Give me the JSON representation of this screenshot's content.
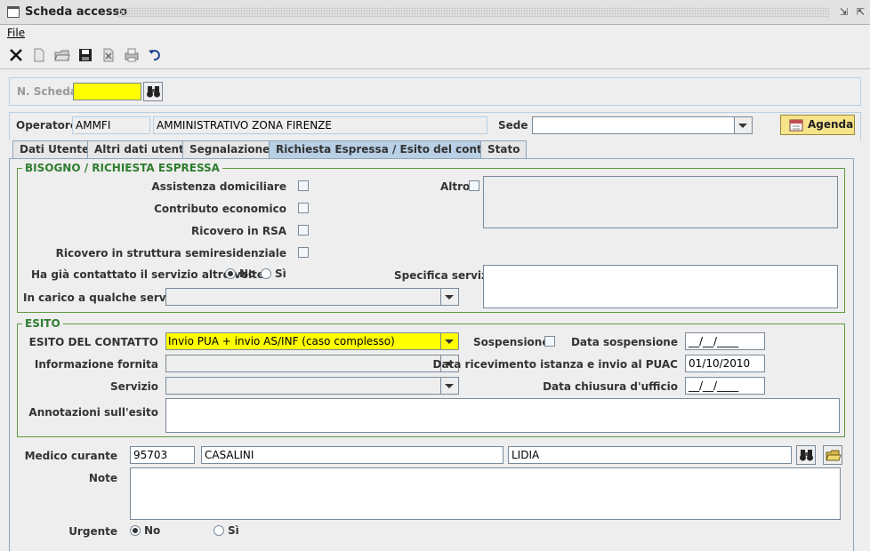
{
  "window": {
    "title": "Scheda accesso"
  },
  "menu": {
    "file": "File"
  },
  "toolbar": {
    "icons": [
      "delete-icon",
      "new-icon",
      "open-icon",
      "save-icon",
      "clear-icon",
      "print-icon",
      "undo-icon"
    ]
  },
  "scheda": {
    "label": "N. Scheda",
    "value": ""
  },
  "operatore": {
    "label": "Operatore",
    "code": "AMMFI",
    "name": "AMMINISTRATIVO ZONA FIRENZE"
  },
  "sede": {
    "label": "Sede",
    "value": ""
  },
  "agenda": {
    "label": "Agenda"
  },
  "tabs": [
    "Dati Utente",
    "Altri dati utente",
    "Segnalazione",
    "Richiesta Espressa / Esito del contatto",
    "Stato"
  ],
  "bisogno": {
    "title": "BISOGNO / RICHIESTA ESPRESSA",
    "assistenza": "Assistenza domiciliare",
    "contributo": "Contributo economico",
    "ricovero_rsa": "Ricovero in RSA",
    "ricovero_semi": "Ricovero in struttura semiresidenziale",
    "altro": "Altro",
    "contattato": "Ha già contattato il servizio altre volte",
    "no": "No",
    "si": "Sì",
    "specifica": "Specifica servizi",
    "in_carico": "In carico a qualche servizio",
    "in_carico_value": ""
  },
  "esito": {
    "title": "ESITO",
    "esito_label": "ESITO DEL CONTATTO",
    "esito_value": "Invio PUA + invio AS/INF (caso complesso)",
    "sospensione": "Sospensione",
    "data_sospensione_label": "Data sospensione",
    "data_sospensione": "__/__/____",
    "informazione_label": "Informazione fornita",
    "informazione_value": "",
    "data_ricevimento_label": "Data ricevimento istanza e invio al PUAC",
    "data_ricevimento": "01/10/2010",
    "servizio_label": "Servizio",
    "servizio_value": "",
    "data_chiusura_label": "Data chiusura d'ufficio",
    "data_chiusura": "__/__/____",
    "annotazioni_label": "Annotazioni sull'esito"
  },
  "medico": {
    "label": "Medico curante",
    "code": "95703",
    "cognome": "CASALINI",
    "nome": "LIDIA"
  },
  "note": {
    "label": "Note"
  },
  "urgente": {
    "label": "Urgente",
    "no": "No",
    "si": "Sì"
  },
  "colors": {
    "highlight": "#ffff00",
    "group_border": "#5f9a3f",
    "tab_active": "#b8cfe5"
  }
}
